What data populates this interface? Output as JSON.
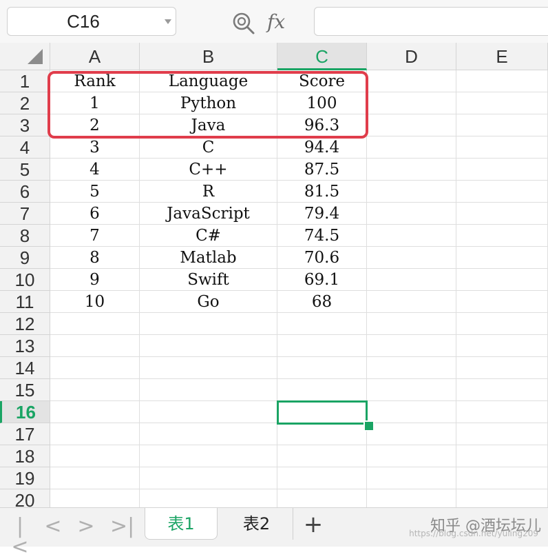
{
  "formula_bar": {
    "name_box": "C16",
    "fx_label": "fx",
    "formula_value": ""
  },
  "columns": [
    "A",
    "B",
    "C",
    "D",
    "E"
  ],
  "rows": [
    "1",
    "2",
    "3",
    "4",
    "5",
    "6",
    "7",
    "8",
    "9",
    "10",
    "11",
    "12",
    "13",
    "14",
    "15",
    "16",
    "17",
    "18",
    "19",
    "20"
  ],
  "active_cell": {
    "column": "C",
    "row": "16"
  },
  "table": {
    "header": [
      "Rank",
      "Language",
      "Score"
    ],
    "data": [
      [
        "1",
        "Python",
        "100"
      ],
      [
        "2",
        "Java",
        "96.3"
      ],
      [
        "3",
        "C",
        "94.4"
      ],
      [
        "4",
        "C++",
        "87.5"
      ],
      [
        "5",
        "R",
        "81.5"
      ],
      [
        "6",
        "JavaScript",
        "79.4"
      ],
      [
        "7",
        "C#",
        "74.5"
      ],
      [
        "8",
        "Matlab",
        "70.6"
      ],
      [
        "9",
        "Swift",
        "69.1"
      ],
      [
        "10",
        "Go",
        "68"
      ]
    ]
  },
  "sheet_tabs": [
    {
      "label": "表1",
      "active": true
    },
    {
      "label": "表2",
      "active": false
    }
  ],
  "nav_buttons": [
    "|<",
    "<",
    ">",
    ">|"
  ],
  "add_sheet_label": "+",
  "watermark": {
    "text": "知乎 @酒坛坛儿",
    "subtext": "https://blog.csdn.net/yuling209"
  },
  "colors": {
    "accent_green": "#1aa464",
    "highlight_red": "#e03d4b",
    "header_bg": "#f2f2f2",
    "grid_line": "#dedede"
  }
}
